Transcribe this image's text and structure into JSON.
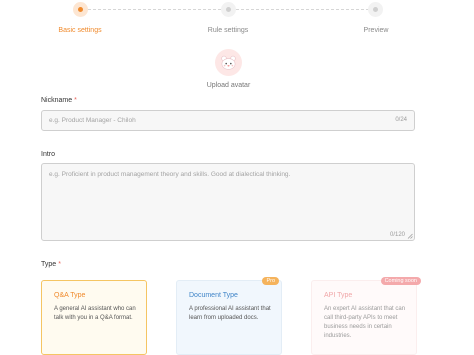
{
  "steps": [
    {
      "label": "Basic settings",
      "active": true
    },
    {
      "label": "Rule settings",
      "active": false
    },
    {
      "label": "Preview",
      "active": false
    }
  ],
  "avatar": {
    "label": "Upload avatar",
    "icon": "bear-avatar-icon"
  },
  "nickname": {
    "label": "Nickname",
    "required_mark": "*",
    "placeholder": "e.g. Product Manager - Chiloh",
    "counter": "0/24"
  },
  "intro": {
    "label": "Intro",
    "placeholder": "e.g. Proficient in product management theory and skills. Good at dialectical thinking.",
    "counter": "0/120"
  },
  "type": {
    "label": "Type",
    "required_mark": "*",
    "cards": [
      {
        "title": "Q&A Type",
        "desc": "A general AI assistant who can talk with you in a Q&A format.",
        "selected": true,
        "badge": "",
        "disabled": false
      },
      {
        "title": "Document Type",
        "desc": "A professional AI assistant that learn from uploaded docs.",
        "selected": false,
        "badge": "Pro",
        "disabled": false
      },
      {
        "title": "API Type",
        "desc": "An expert AI assistant that can call third-party APIs to meet business needs in certain industries.",
        "selected": false,
        "badge": "Coming soon",
        "disabled": true
      }
    ]
  },
  "colors": {
    "accent": "#f08a2c",
    "required": "#e9645b",
    "pro_badge": "#f5b35c",
    "soon_badge": "#f4a9ab"
  }
}
